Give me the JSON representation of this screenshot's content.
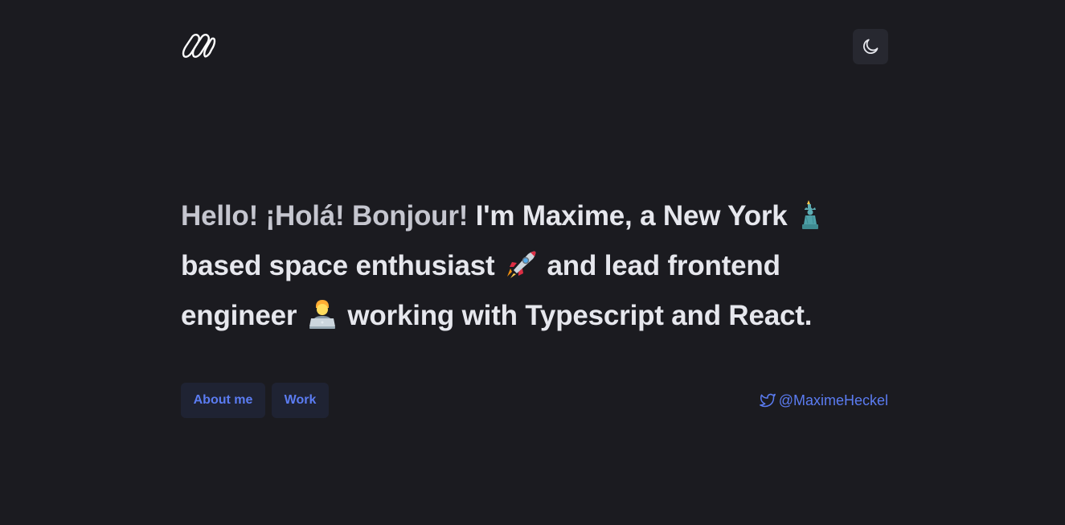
{
  "header": {
    "logo_icon": "mh-logo-icon",
    "theme_toggle_icon": "moon-icon"
  },
  "intro": {
    "greeting": "Hello! ¡Holá! Bonjour!",
    "part1": "I'm Maxime, a New York",
    "emoji1": "statue-of-liberty-icon",
    "part2": "based space enthusiast",
    "emoji2": "rocket-icon",
    "part3": "and lead frontend engineer",
    "emoji3": "technologist-icon",
    "part4": "working with Typescript and React."
  },
  "actions": {
    "about_label": "About me",
    "work_label": "Work",
    "twitter_handle": "@MaximeHeckel",
    "twitter_icon": "twitter-icon"
  },
  "colors": {
    "background": "#1b1b20",
    "text": "#e6e7ed",
    "greeting_text": "#c5c6cf",
    "accent": "#5b7cf2",
    "button_bg": "#1f2333",
    "toggle_bg": "#272830"
  }
}
